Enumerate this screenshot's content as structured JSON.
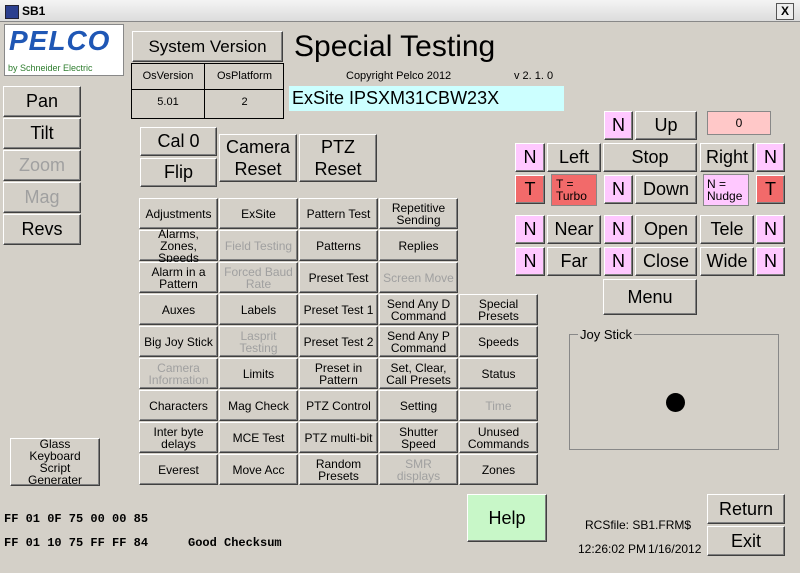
{
  "window": {
    "title": "SB1",
    "close": "X"
  },
  "logo": {
    "brand": "PELCO",
    "byline": "by Schneider Electric"
  },
  "system_version_button": "System Version",
  "os": {
    "version_header": "OsVersion",
    "platform_header": "OsPlatform",
    "version": "5.01",
    "platform": "2"
  },
  "header": {
    "title": "Special Testing",
    "copyright": "Copyright Pelco 2012",
    "version": "v 2. 1. 0",
    "model": "ExSite IPSXM31CBW23X"
  },
  "left_buttons": {
    "pan": "Pan",
    "tilt": "Tilt",
    "zoom": "Zoom",
    "mag": "Mag",
    "revs": "Revs"
  },
  "top_buttons": {
    "cal0": "Cal 0",
    "flip": "Flip",
    "camera_reset_1": "Camera",
    "camera_reset_2": "Reset",
    "ptz_reset_1": "PTZ",
    "ptz_reset_2": "Reset"
  },
  "grid": [
    [
      "Adjustments",
      "ExSite",
      "Pattern Test",
      "Repetitive Sending",
      ""
    ],
    [
      "Alarms, Zones, Speeds",
      "Field Testing",
      "Patterns",
      "Replies",
      ""
    ],
    [
      "Alarm in a Pattern",
      "Forced Baud Rate",
      "Preset Test",
      "Screen Move",
      ""
    ],
    [
      "Auxes",
      "Labels",
      "Preset Test 1",
      "Send Any D Command",
      "Special Presets"
    ],
    [
      "Big Joy Stick",
      "Lasprit Testing",
      "Preset Test 2",
      "Send Any P Command",
      "Speeds"
    ],
    [
      "Camera Information",
      "Limits",
      "Preset in Pattern",
      "Set, Clear, Call Presets",
      "Status"
    ],
    [
      "Characters",
      "Mag Check",
      "PTZ Control",
      "Setting",
      "Time"
    ],
    [
      "Inter byte delays",
      "MCE Test",
      "PTZ multi-bit",
      "Shutter Speed",
      "Unused Commands"
    ],
    [
      "Everest",
      "Move Acc",
      "Random Presets",
      "SMR displays",
      "Zones"
    ]
  ],
  "ptz": {
    "n": "N",
    "t": "T",
    "up": "Up",
    "left": "Left",
    "stop": "Stop",
    "right": "Right",
    "down": "Down",
    "turbo": "T = Turbo",
    "nudge": "N = Nudge",
    "near": "Near",
    "far": "Far",
    "open": "Open",
    "close": "Close",
    "tele": "Tele",
    "wide": "Wide",
    "menu": "Menu",
    "counter": "0"
  },
  "joystick": {
    "label": "Joy Stick"
  },
  "glass_keyboard": "Glass Keyboard Script Generater",
  "hex": {
    "line1": "FF 01 0F 75 00 00 85",
    "line2": "FF 01 10 75 FF FF 84",
    "checksum": "Good Checksum"
  },
  "help": "Help",
  "rcs": {
    "file": "RCSfile: SB1.FRM$",
    "time": "12:26:02 PM",
    "date": "1/16/2012"
  },
  "return": "Return",
  "exit": "Exit"
}
